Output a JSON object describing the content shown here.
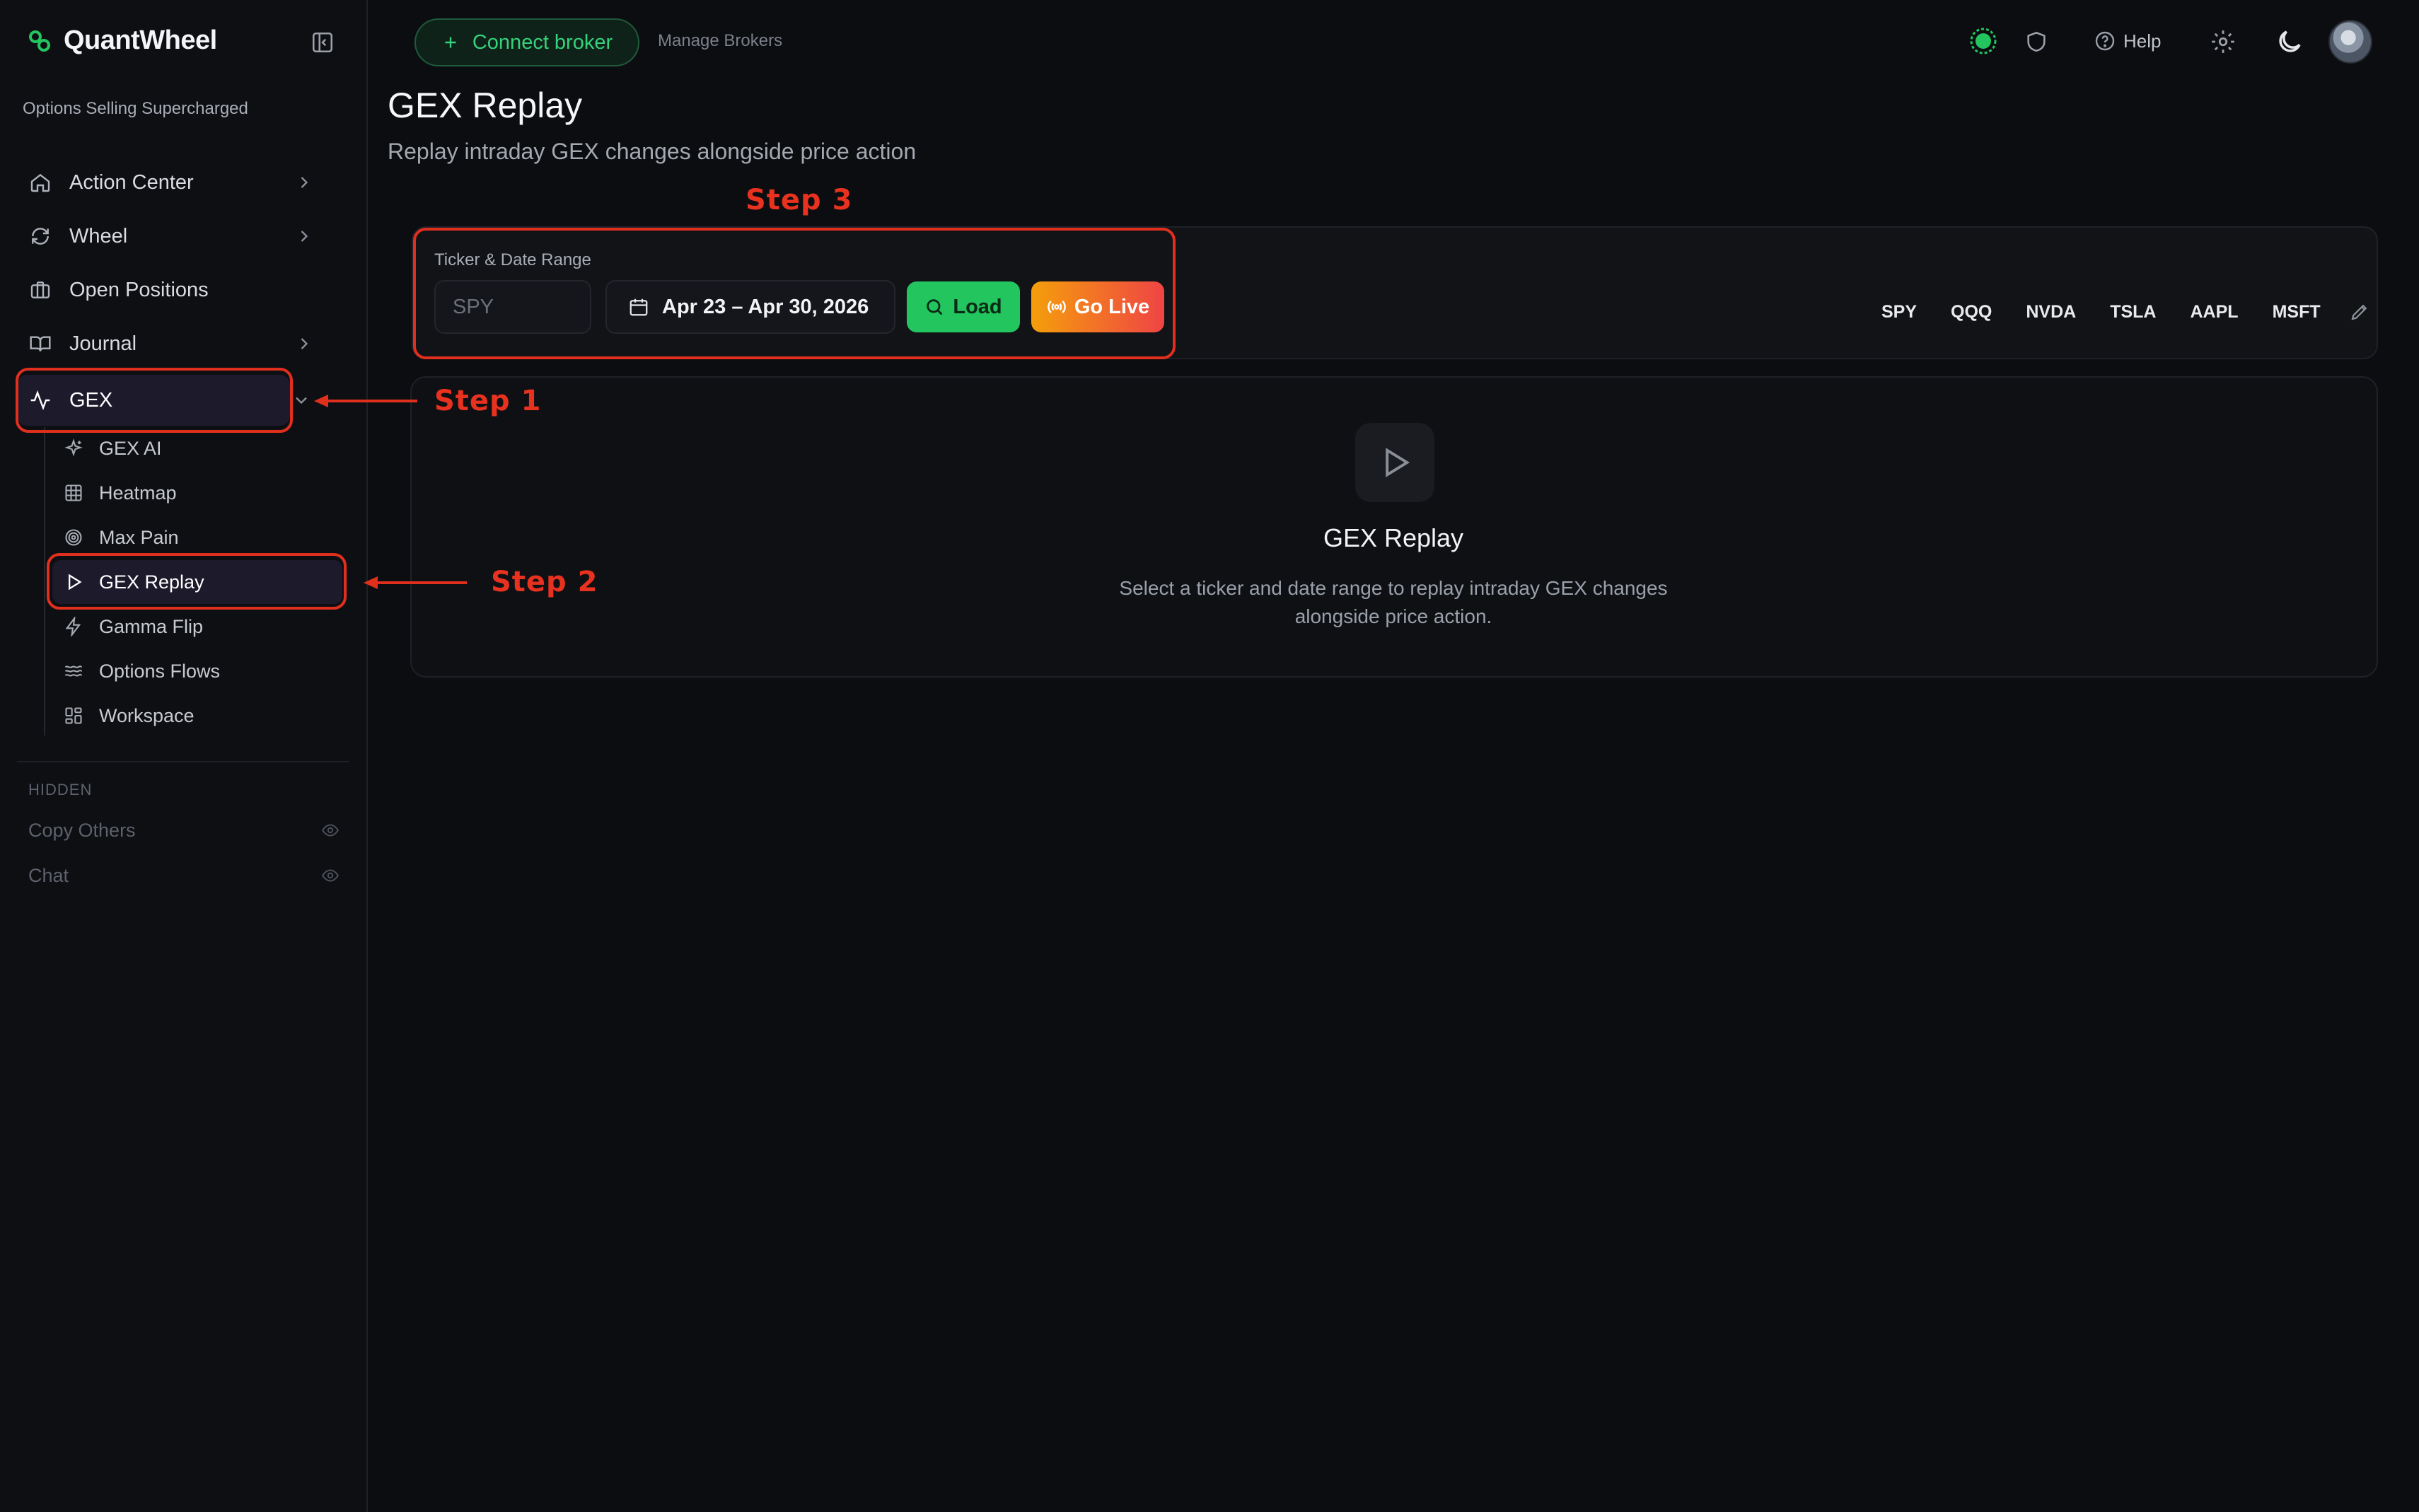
{
  "app": {
    "brand_name": "QuantWheel",
    "tagline": "Options Selling Supercharged"
  },
  "sidebar": {
    "items": [
      {
        "label": "Action Center",
        "icon": "home-icon",
        "has_chevron": true
      },
      {
        "label": "Wheel",
        "icon": "refresh-icon",
        "has_chevron": true
      },
      {
        "label": "Open Positions",
        "icon": "briefcase-icon",
        "has_chevron": false
      },
      {
        "label": "Journal",
        "icon": "book-icon",
        "has_chevron": true
      },
      {
        "label": "GEX",
        "icon": "activity-icon",
        "has_chevron": true,
        "active": true
      }
    ],
    "gex_subitems": [
      {
        "label": "GEX AI",
        "icon": "sparkle-icon"
      },
      {
        "label": "Heatmap",
        "icon": "grid-icon"
      },
      {
        "label": "Max Pain",
        "icon": "target-icon"
      },
      {
        "label": "GEX Replay",
        "icon": "play-icon",
        "active": true
      },
      {
        "label": "Gamma Flip",
        "icon": "bolt-icon"
      },
      {
        "label": "Options Flows",
        "icon": "waves-icon"
      },
      {
        "label": "Workspace",
        "icon": "layout-icon"
      }
    ],
    "hidden_label": "HIDDEN",
    "hidden_items": [
      {
        "label": "Copy Others",
        "icon": "eye-icon"
      },
      {
        "label": "Chat",
        "icon": "eye-icon"
      }
    ]
  },
  "header": {
    "connect_broker_label": "Connect broker",
    "manage_brokers_label": "Manage Brokers",
    "help_label": "Help",
    "status_color": "#22c55e"
  },
  "page": {
    "title": "GEX Replay",
    "subtitle": "Replay intraday GEX changes alongside price action"
  },
  "controls": {
    "field_label": "Ticker & Date Range",
    "ticker_placeholder": "SPY",
    "date_range": "Apr 23 – Apr 30, 2026",
    "load_label": "Load",
    "go_live_label": "Go Live",
    "quick_tickers": [
      "SPY",
      "QQQ",
      "NVDA",
      "TSLA",
      "AAPL",
      "MSFT"
    ]
  },
  "empty_state": {
    "title": "GEX Replay",
    "description_line1": "Select a ticker and date range to replay intraday GEX changes",
    "description_line2": "alongside price action."
  },
  "annotations": {
    "step1": "Step 1",
    "step2": "Step 2",
    "step3": "Step 3",
    "color": "#e12f1e"
  },
  "colors": {
    "accent_green": "#22c55e",
    "live_start": "#f59e0b",
    "live_end": "#ef4444",
    "active_bg": "#1d1a2c"
  }
}
